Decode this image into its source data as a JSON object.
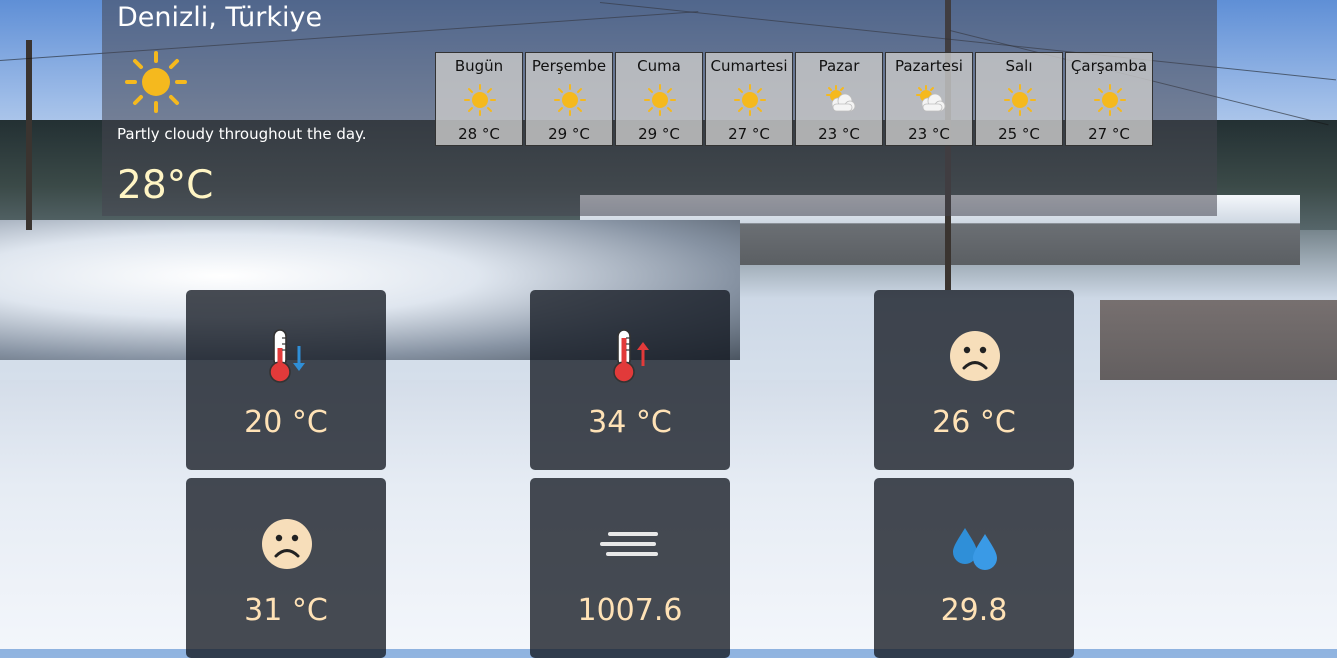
{
  "location": {
    "city": "Denizli, Türkiye"
  },
  "current": {
    "icon": "sun-icon",
    "description": "Partly cloudy throughout the day.",
    "temperature": "28°C"
  },
  "forecast": [
    {
      "day": "Bugün",
      "icon": "sun-icon",
      "temp": "28 °C"
    },
    {
      "day": "Perşembe",
      "icon": "sun-icon",
      "temp": "29 °C"
    },
    {
      "day": "Cuma",
      "icon": "sun-icon",
      "temp": "29 °C"
    },
    {
      "day": "Cumartesi",
      "icon": "sun-icon",
      "temp": "27 °C"
    },
    {
      "day": "Pazar",
      "icon": "partly-cloudy-icon",
      "temp": "23 °C"
    },
    {
      "day": "Pazartesi",
      "icon": "partly-cloudy-icon",
      "temp": "23 °C"
    },
    {
      "day": "Salı",
      "icon": "sun-icon",
      "temp": "25 °C"
    },
    {
      "day": "Çarşamba",
      "icon": "sun-icon",
      "temp": "27 °C"
    }
  ],
  "stats": [
    {
      "name": "min-temp",
      "icon": "thermometer-down-icon",
      "value": "20 °C"
    },
    {
      "name": "max-temp",
      "icon": "thermometer-up-icon",
      "value": "34 °C"
    },
    {
      "name": "feels-like-day",
      "icon": "sad-face-icon",
      "value": "26 °C"
    },
    {
      "name": "feels-like-max",
      "icon": "sad-face-icon",
      "value": "31 °C"
    },
    {
      "name": "pressure",
      "icon": "wind-lines-icon",
      "value": "1007.6"
    },
    {
      "name": "humidity",
      "icon": "water-drops-icon",
      "value": "29.8"
    }
  ],
  "colors": {
    "temp_text": "#fff5c4",
    "card_value": "#ffe2b6",
    "sun": "#f5b91e",
    "thermo_red": "#e23a3a",
    "arrow_down": "#2f8fd8",
    "arrow_up": "#e23a3a",
    "drop": "#2f8fd8"
  }
}
